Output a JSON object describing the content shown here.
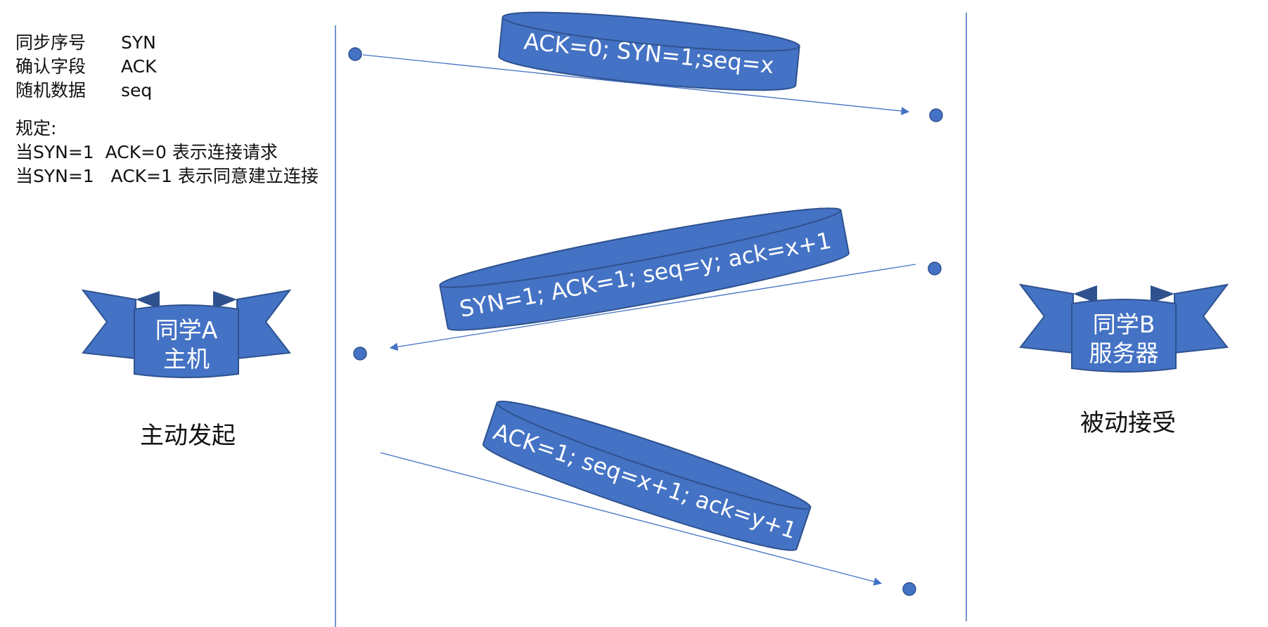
{
  "legend": {
    "rows": [
      {
        "name": "同步序号",
        "abbr": "SYN"
      },
      {
        "name": "确认字段",
        "abbr": "ACK"
      },
      {
        "name": "随机数据",
        "abbr": "seq"
      }
    ],
    "rules_title": "规定:",
    "rules": [
      "当SYN=1  ACK=0 表示连接请求",
      "当SYN=1   ACK=1 表示同意建立连接"
    ]
  },
  "client": {
    "badge_line1": "同学A",
    "badge_line2": "主机",
    "caption": "主动发起"
  },
  "server": {
    "badge_line1": "同学B",
    "badge_line2": "服务器",
    "caption": "被动接受"
  },
  "messages": [
    {
      "label": "ACK=0; SYN=1;seq=x",
      "direction": "A→B"
    },
    {
      "label": "SYN=1; ACK=1; seq=y; ack=x+1",
      "direction": "B→A"
    },
    {
      "label": "ACK=1; seq=x+1; ack=y+1",
      "direction": "A→B"
    }
  ],
  "colors": {
    "shape_fill": "#4472C4",
    "shape_stroke": "#2F528F",
    "line": "#4472C4",
    "text_on_shape": "#ffffff"
  }
}
